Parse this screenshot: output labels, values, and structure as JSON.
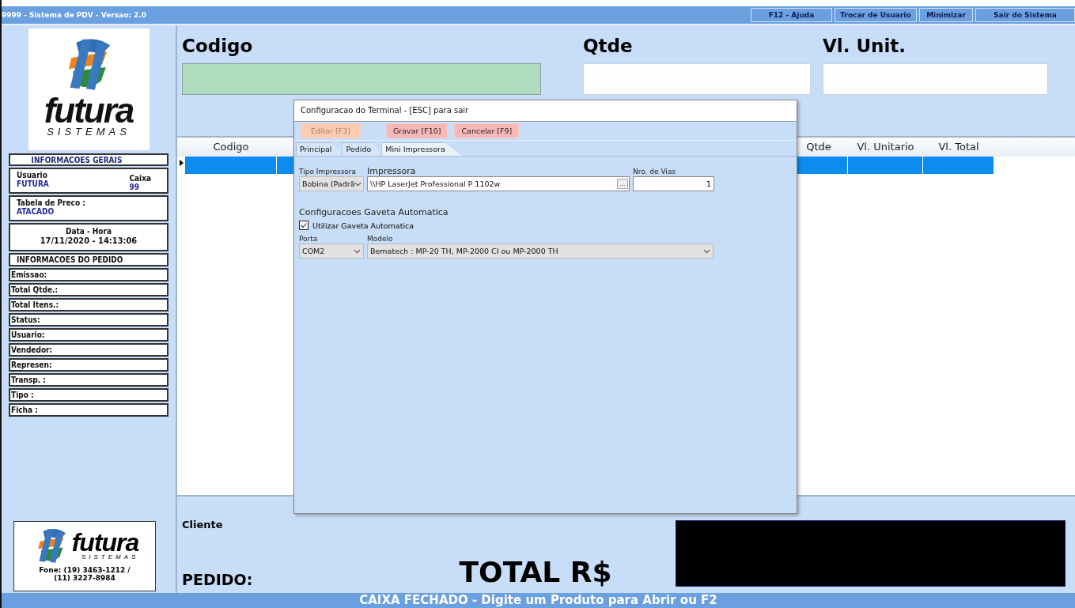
{
  "window": {
    "title": "9999 - Sistema de PDV - Versao: 2.0",
    "buttons": [
      "F12 - Ajuda",
      "Trocar de Usuario",
      "Minimizar",
      "Sair do Sistema"
    ]
  },
  "sidebar": {
    "logo": {
      "wordmark": "futura",
      "tagline": "SISTEMAS"
    },
    "general_header": "INFORMACOES GERAIS",
    "user_label": "Usuario",
    "user_value": "FUTURA",
    "register_label": "Caixa",
    "register_value": "99",
    "price_table_label": "Tabela de Preco :",
    "price_table_value": "ATACADO",
    "datetime_label": "Data - Hora",
    "datetime_value": "17/11/2020 - 14:13:06",
    "order_header": "INFORMACOES DO PEDIDO",
    "order_fields": [
      "Emissao:",
      "Total Qtde.:",
      "Total Itens.:",
      "Status:",
      "Usuario:",
      "Vendedor:",
      "Represen:",
      "Transp. :",
      "Tipo :",
      "Ficha :"
    ],
    "footer_logo": {
      "wordmark": "futura",
      "tagline": "SISTEMAS",
      "phone": "Fone: (19) 3463-1212 / (11) 3227-8984"
    }
  },
  "entry": {
    "fields": [
      {
        "label": "Codigo",
        "kind": "active"
      },
      {
        "label": "Qtde",
        "kind": "plain"
      },
      {
        "label": "Vl. Unit.",
        "kind": "plain"
      }
    ]
  },
  "grid": {
    "columns": [
      "Codigo",
      "Qtde",
      "Vl. Unitario",
      "Vl. Total"
    ],
    "rows": [
      {
        "selected": true
      }
    ]
  },
  "footer": {
    "client_label": "Cliente",
    "order_label": "PEDIDO:",
    "total_label": "TOTAL R$"
  },
  "status_bar": "CAIXA FECHADO - Digite um Produto para Abrir ou F2",
  "dialog": {
    "title": "Configuracao do Terminal - [ESC] para sair",
    "buttons": [
      {
        "label": "Editar [F3]",
        "disabled": true
      },
      {
        "label": "Gravar [F10]",
        "disabled": false
      },
      {
        "label": "Cancelar [F9]",
        "disabled": false
      }
    ],
    "tabs": [
      {
        "label": "Principal",
        "selected": false
      },
      {
        "label": "Pedido",
        "selected": false
      },
      {
        "label": "Mini Impressora",
        "selected": true
      }
    ],
    "printer_type": {
      "label": "Tipo Impressora",
      "value": "Bobina (Padrã"
    },
    "printer": {
      "label": "Impressora",
      "value": "\\\\HP LaserJet Professional P 1102w",
      "browse": "..."
    },
    "copies": {
      "label": "Nro. de Vias",
      "value": "1"
    },
    "drawer_section": "Configuracoes Gaveta Automatica",
    "drawer_checkbox": {
      "label": "Utilizar Gaveta Automatica",
      "checked": true
    },
    "port": {
      "label": "Porta",
      "value": "COM2"
    },
    "model": {
      "label": "Modelo",
      "value": "Bematech : MP-20 TH, MP-2000 CI ou MP-2000 TH"
    }
  }
}
